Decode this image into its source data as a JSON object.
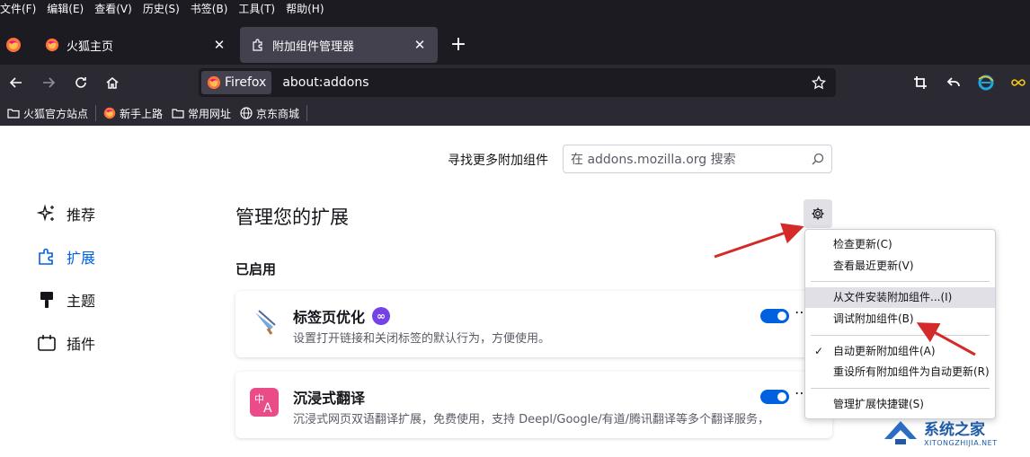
{
  "menubar": [
    "文件(F)",
    "编辑(E)",
    "查看(V)",
    "历史(S)",
    "书签(B)",
    "工具(T)",
    "帮助(H)"
  ],
  "tabs": [
    {
      "title": "火狐主页",
      "close": "✕"
    },
    {
      "title": "附加组件管理器",
      "close": "✕"
    }
  ],
  "newtab": "+",
  "urlbar": {
    "identity": "Firefox",
    "url": "about:addons"
  },
  "bookmarks": [
    {
      "label": "火狐官方站点",
      "icon": "folder-icon"
    },
    {
      "label": "新手上路",
      "icon": "firefox-icon"
    },
    {
      "label": "常用网址",
      "icon": "folder-icon"
    },
    {
      "label": "京东商城",
      "icon": "globe-icon"
    }
  ],
  "findmore": {
    "label": "寻找更多附加组件",
    "placeholder": "在 addons.mozilla.org 搜索"
  },
  "sidebar": [
    {
      "label": "推荐",
      "icon": "sparkle-icon"
    },
    {
      "label": "扩展",
      "icon": "puzzle-icon"
    },
    {
      "label": "主题",
      "icon": "brush-icon"
    },
    {
      "label": "插件",
      "icon": "plugin-icon"
    }
  ],
  "main": {
    "heading": "管理您的扩展",
    "section": "已启用"
  },
  "extensions": [
    {
      "name": "标签页优化",
      "desc": "设置打开链接和关闭标签的默认行为，方便使用。",
      "enabled": true
    },
    {
      "name": "沉浸式翻译",
      "desc": "沉浸式网页双语翻译扩展，免费使用，支持 Deepl/Google/有道/腾讯翻译等多个翻译服务，",
      "enabled": true
    }
  ],
  "menu": {
    "items": [
      "检查更新(C)",
      "查看最近更新(V)",
      "从文件安装附加组件...(I)",
      "调试附加组件(B)",
      "自动更新附加组件(A)",
      "重设所有附加组件为自动更新(R)",
      "管理扩展快捷键(S)"
    ],
    "highlighted_index": 2,
    "checked_index": 4,
    "check": "✓"
  },
  "watermark": {
    "title": "系统之家",
    "subtitle": "XITONGZHIJIA.NET"
  },
  "colors": {
    "accent": "#0061e0",
    "arrow": "#d42a2a",
    "chrome": "#1c1b22",
    "toolbar": "#2b2a33"
  }
}
